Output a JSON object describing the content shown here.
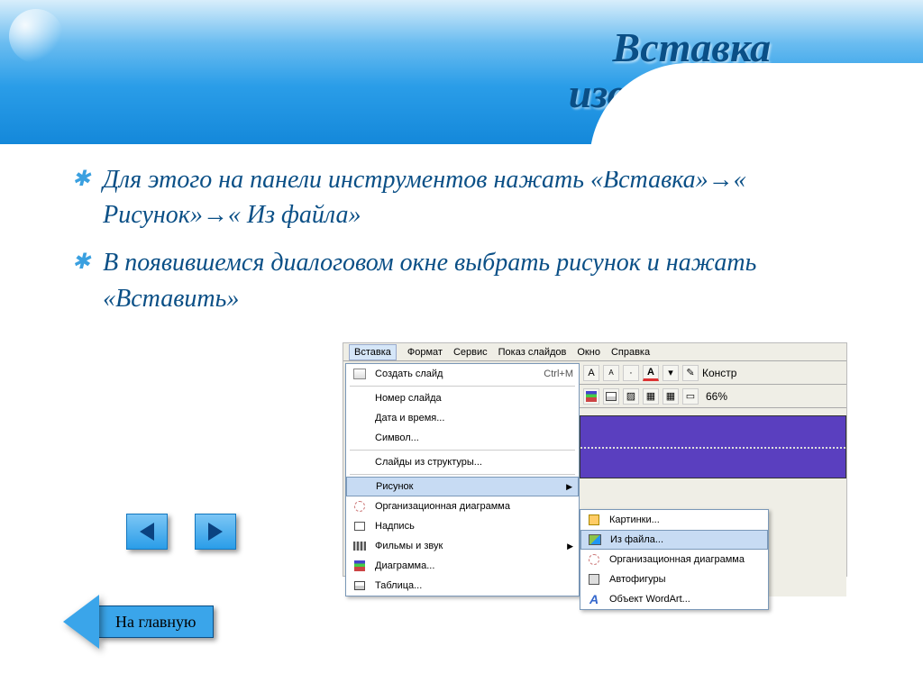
{
  "title_line1": "Вставка",
  "title_line2": "изображения",
  "bullets": [
    "Для этого на панели инструментов нажать «Вставка»→« Рисунок»→« Из файла»",
    "В появившемся диалоговом окне выбрать рисунок и нажать «Вставить»"
  ],
  "menubar": [
    "Вставка",
    "Формат",
    "Сервис",
    "Показ слайдов",
    "Окно",
    "Справка"
  ],
  "dropdown": {
    "new_slide": "Создать слайд",
    "new_slide_shortcut": "Ctrl+M",
    "slide_number": "Номер слайда",
    "date_time": "Дата и время...",
    "symbol": "Символ...",
    "slides_from": "Слайды из структуры...",
    "picture": "Рисунок",
    "org_chart": "Организационная диаграмма",
    "textbox": "Надпись",
    "movies_sound": "Фильмы и звук",
    "chart": "Диаграмма...",
    "table": "Таблица..."
  },
  "submenu": {
    "clipart": "Картинки...",
    "from_file": "Из файла...",
    "org": "Организационная диаграмма",
    "autoshapes": "Автофигуры",
    "wordart": "Объект WordArt..."
  },
  "toolbar": {
    "constr": "Констр",
    "zoom": "66%",
    "A": "A"
  },
  "nav": {
    "home": "На главную"
  }
}
